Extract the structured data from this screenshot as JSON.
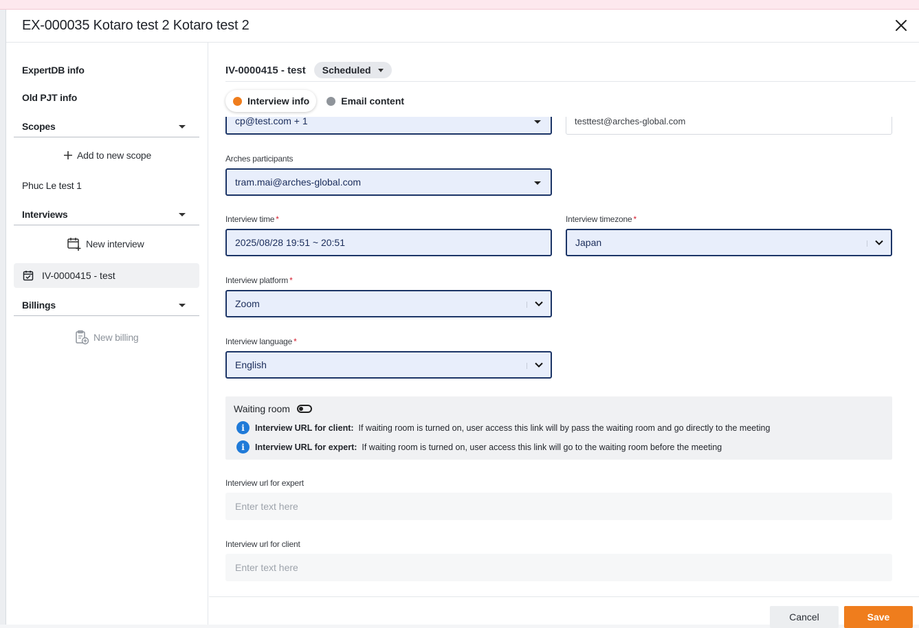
{
  "modal": {
    "title": "EX-000035 Kotaro test 2 Kotaro test 2"
  },
  "sidebar": {
    "expertdb_info": "ExpertDB info",
    "old_pjt_info": "Old PJT info",
    "scopes_label": "Scopes",
    "add_scope_label": "Add to new scope",
    "scope_item": "Phuc Le test 1",
    "interviews_label": "Interviews",
    "new_interview_label": "New interview",
    "interview_item": "IV-0000415 - test",
    "billings_label": "Billings",
    "new_billing_label": "New billing"
  },
  "interview": {
    "title": "IV-0000415 - test",
    "status": "Scheduled",
    "tabs": [
      {
        "label": "Interview info",
        "active": true,
        "dot_color": "#ef7d1d"
      },
      {
        "label": "Email content",
        "active": false,
        "dot_color": "#8f949a"
      }
    ]
  },
  "form": {
    "client_participants_value": "cp@test.com + 1",
    "email_value": "testtest@arches-global.com",
    "arches_participants_label": "Arches participants",
    "arches_participants_value": "tram.mai@arches-global.com",
    "interview_time_label": "Interview time",
    "interview_time_value": "2025/08/28 19:51 ~ 20:51",
    "interview_timezone_label": "Interview timezone",
    "interview_timezone_value": "Japan",
    "interview_platform_label": "Interview platform",
    "interview_platform_value": "Zoom",
    "interview_language_label": "Interview language",
    "interview_language_value": "English",
    "required_mark": "*"
  },
  "waiting_room": {
    "label": "Waiting room",
    "client_url_label": "Interview URL for client:",
    "client_url_text": "If waiting room is turned on, user access this link will by pass the waiting room and go directly to the meeting",
    "expert_url_label": "Interview URL for expert:",
    "expert_url_text": "If waiting room is turned on, user access this link will go to the waiting room before the meeting"
  },
  "urls": {
    "expert_label": "Interview url for expert",
    "expert_placeholder": "Enter text here",
    "client_label": "Interview url for client",
    "client_placeholder": "Enter text here"
  },
  "footer": {
    "cancel_label": "Cancel",
    "save_label": "Save"
  },
  "colors": {
    "accent": "#ef7d1d",
    "select_border": "#1b3466",
    "select_bg": "#e8eefb",
    "info": "#1f7ad8"
  }
}
